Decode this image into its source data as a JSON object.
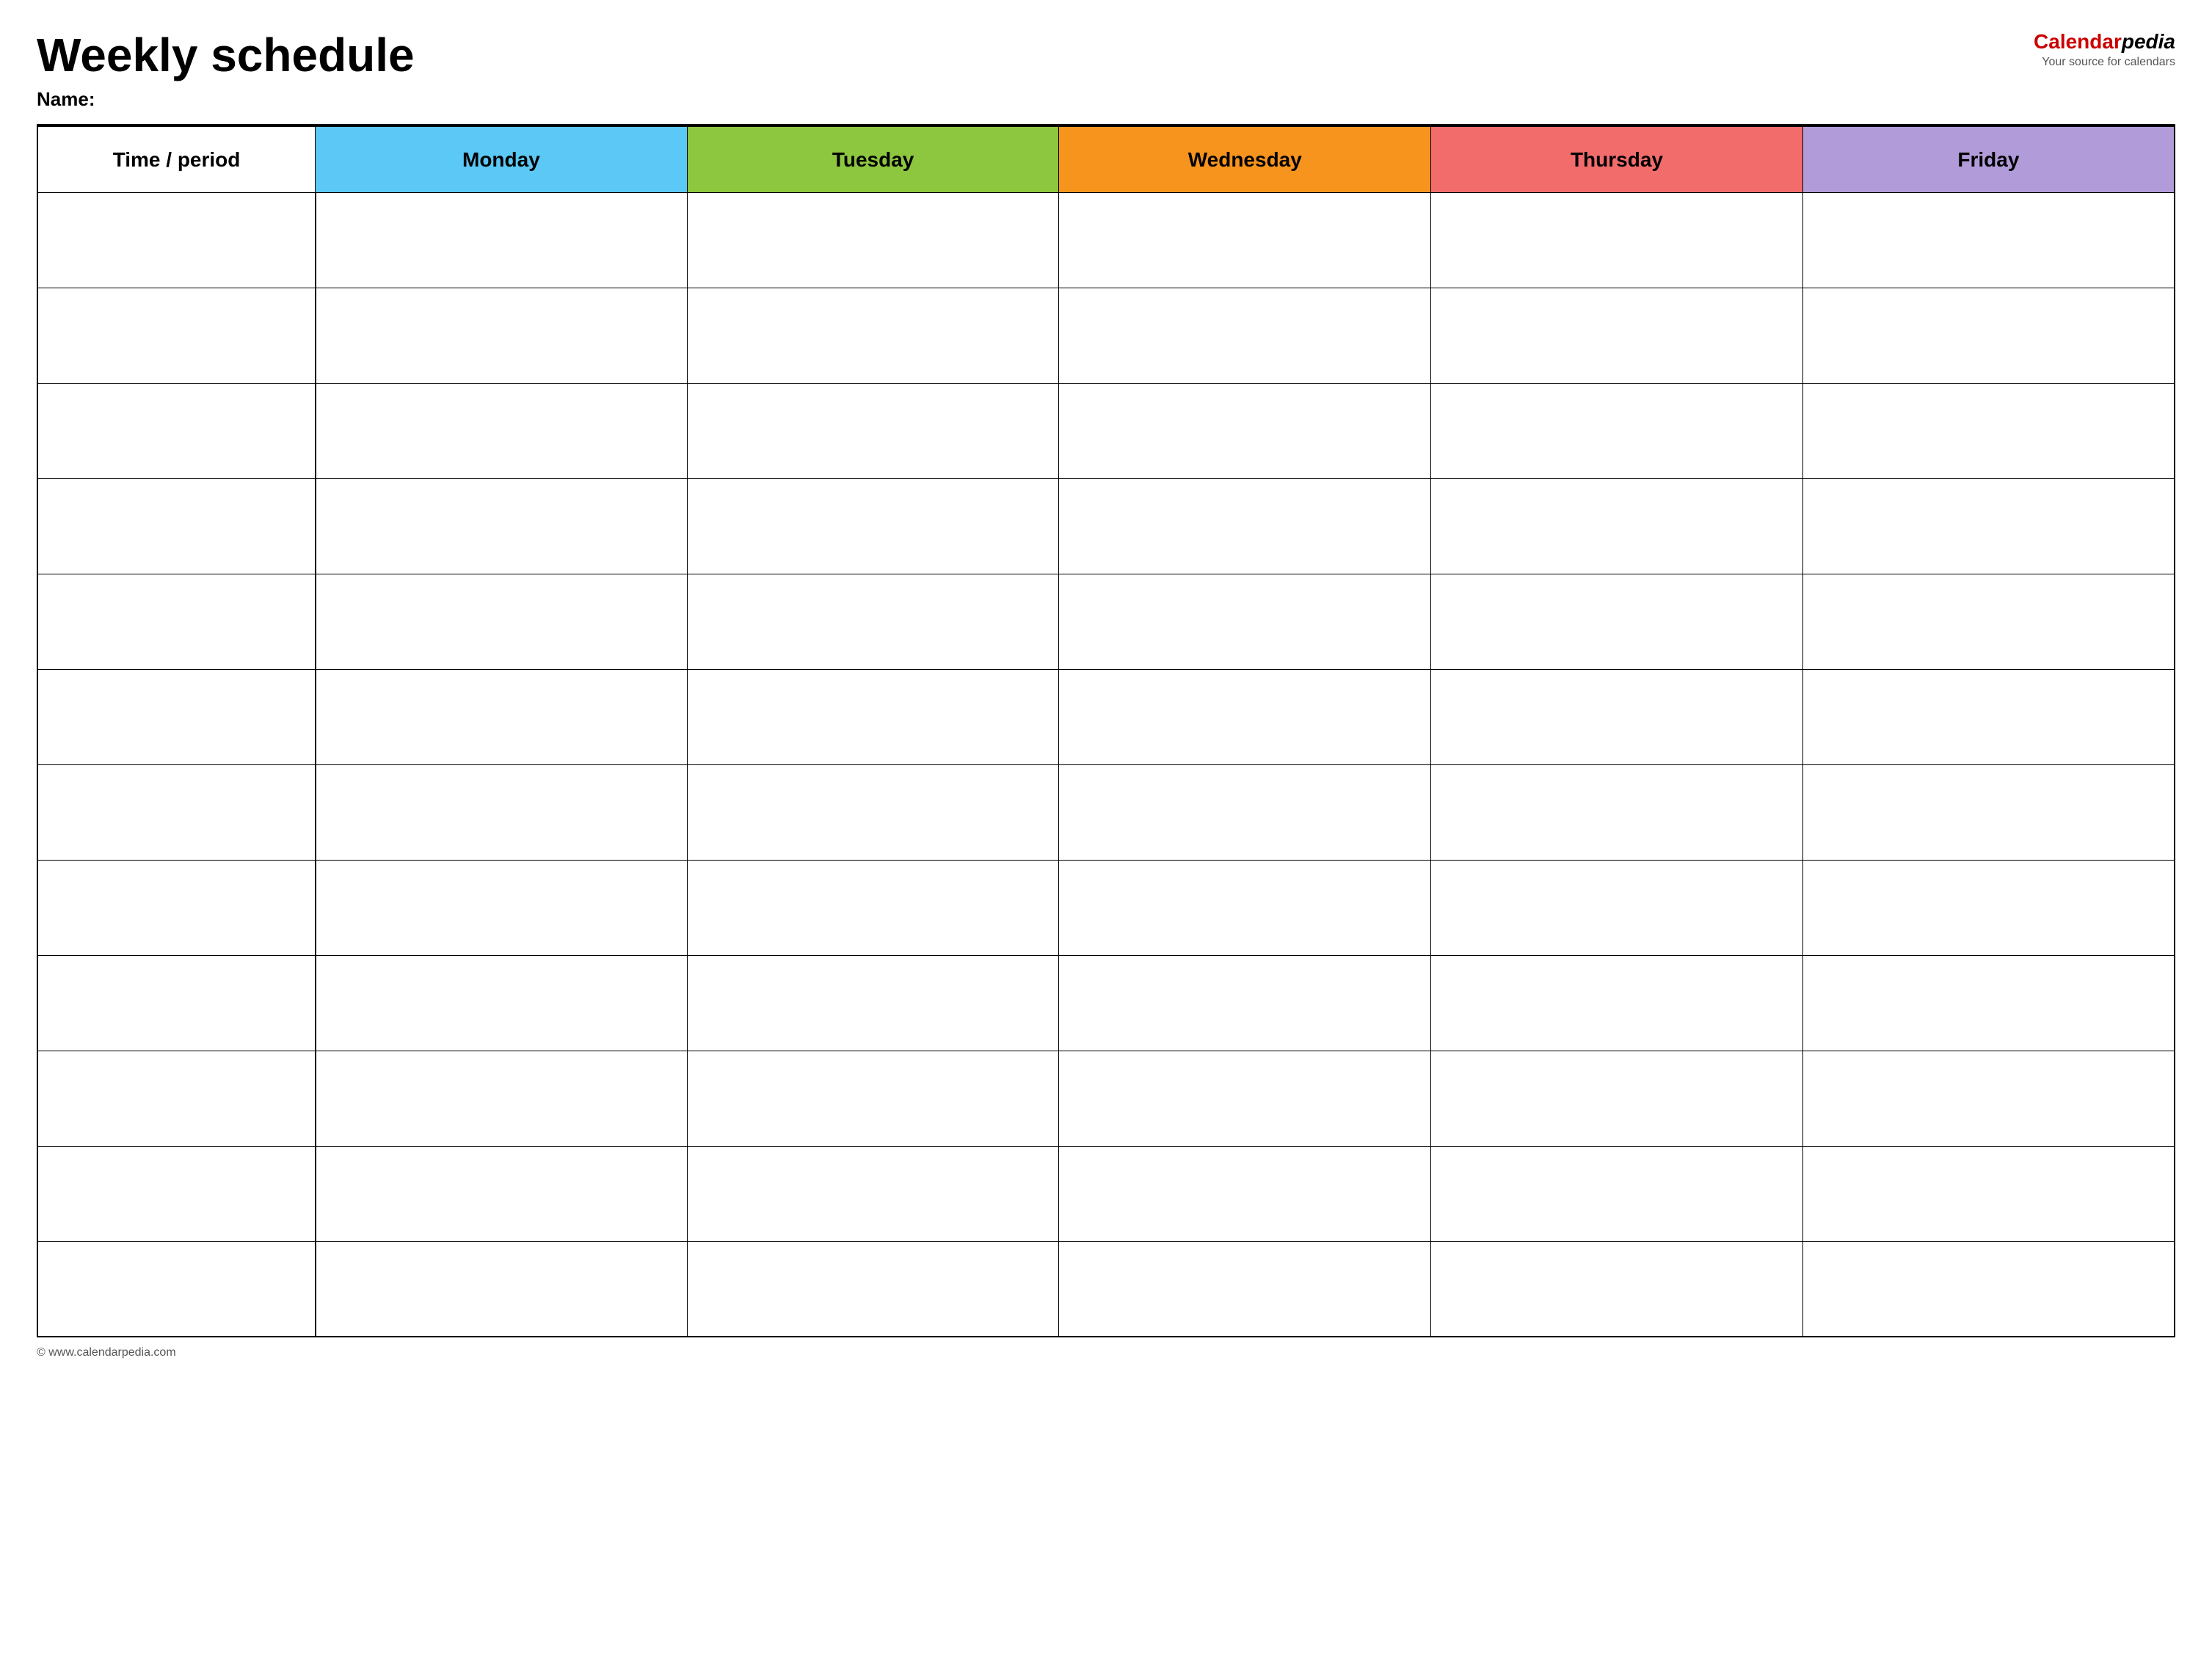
{
  "header": {
    "title": "Weekly schedule",
    "name_label": "Name:",
    "logo": {
      "calendar_part": "Calendar",
      "pedia_part": "pedia",
      "subtitle": "Your source for calendars"
    }
  },
  "table": {
    "columns": [
      {
        "id": "time",
        "label": "Time / period",
        "color": "#ffffff"
      },
      {
        "id": "monday",
        "label": "Monday",
        "color": "#5bc8f5"
      },
      {
        "id": "tuesday",
        "label": "Tuesday",
        "color": "#8dc63f"
      },
      {
        "id": "wednesday",
        "label": "Wednesday",
        "color": "#f7941d"
      },
      {
        "id": "thursday",
        "label": "Thursday",
        "color": "#f26c6c"
      },
      {
        "id": "friday",
        "label": "Friday",
        "color": "#b19cd9"
      }
    ],
    "row_count": 12
  },
  "footer": {
    "url": "© www.calendarpedia.com"
  }
}
